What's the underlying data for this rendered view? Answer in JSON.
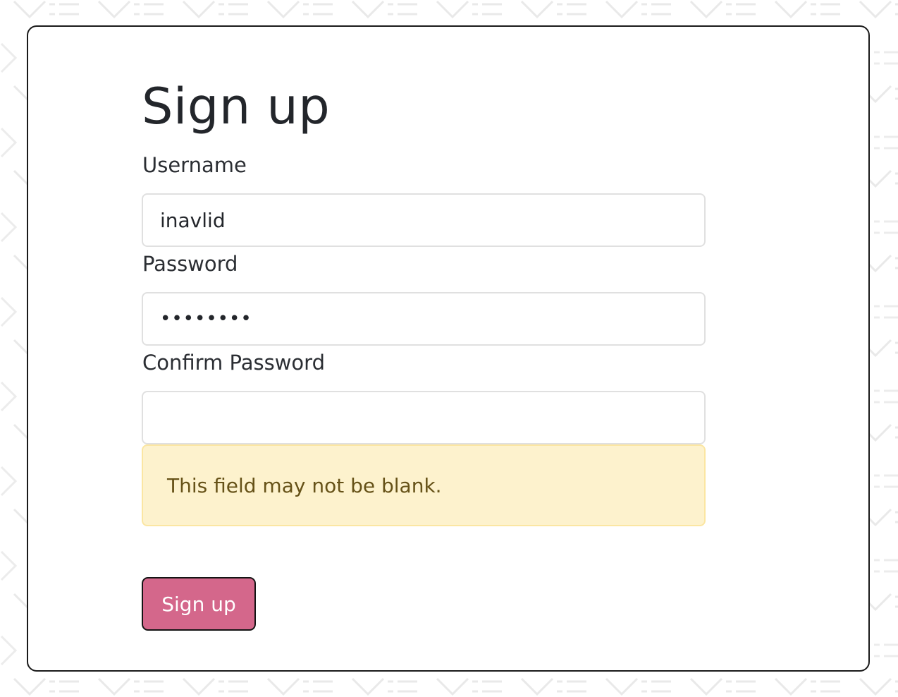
{
  "form": {
    "title": "Sign up",
    "username": {
      "label": "Username",
      "value": "inavlid"
    },
    "password": {
      "label": "Password",
      "value": "••••••••"
    },
    "confirm_password": {
      "label": "Confirm Password",
      "value": ""
    },
    "alert": {
      "message": "This field may not be blank."
    },
    "submit_label": "Sign up"
  },
  "colors": {
    "accent": "#d4678b",
    "alert_bg": "#fdf2cd",
    "alert_border": "#fbe6a2",
    "alert_text": "#665218",
    "card_border": "#1a1a1a"
  }
}
